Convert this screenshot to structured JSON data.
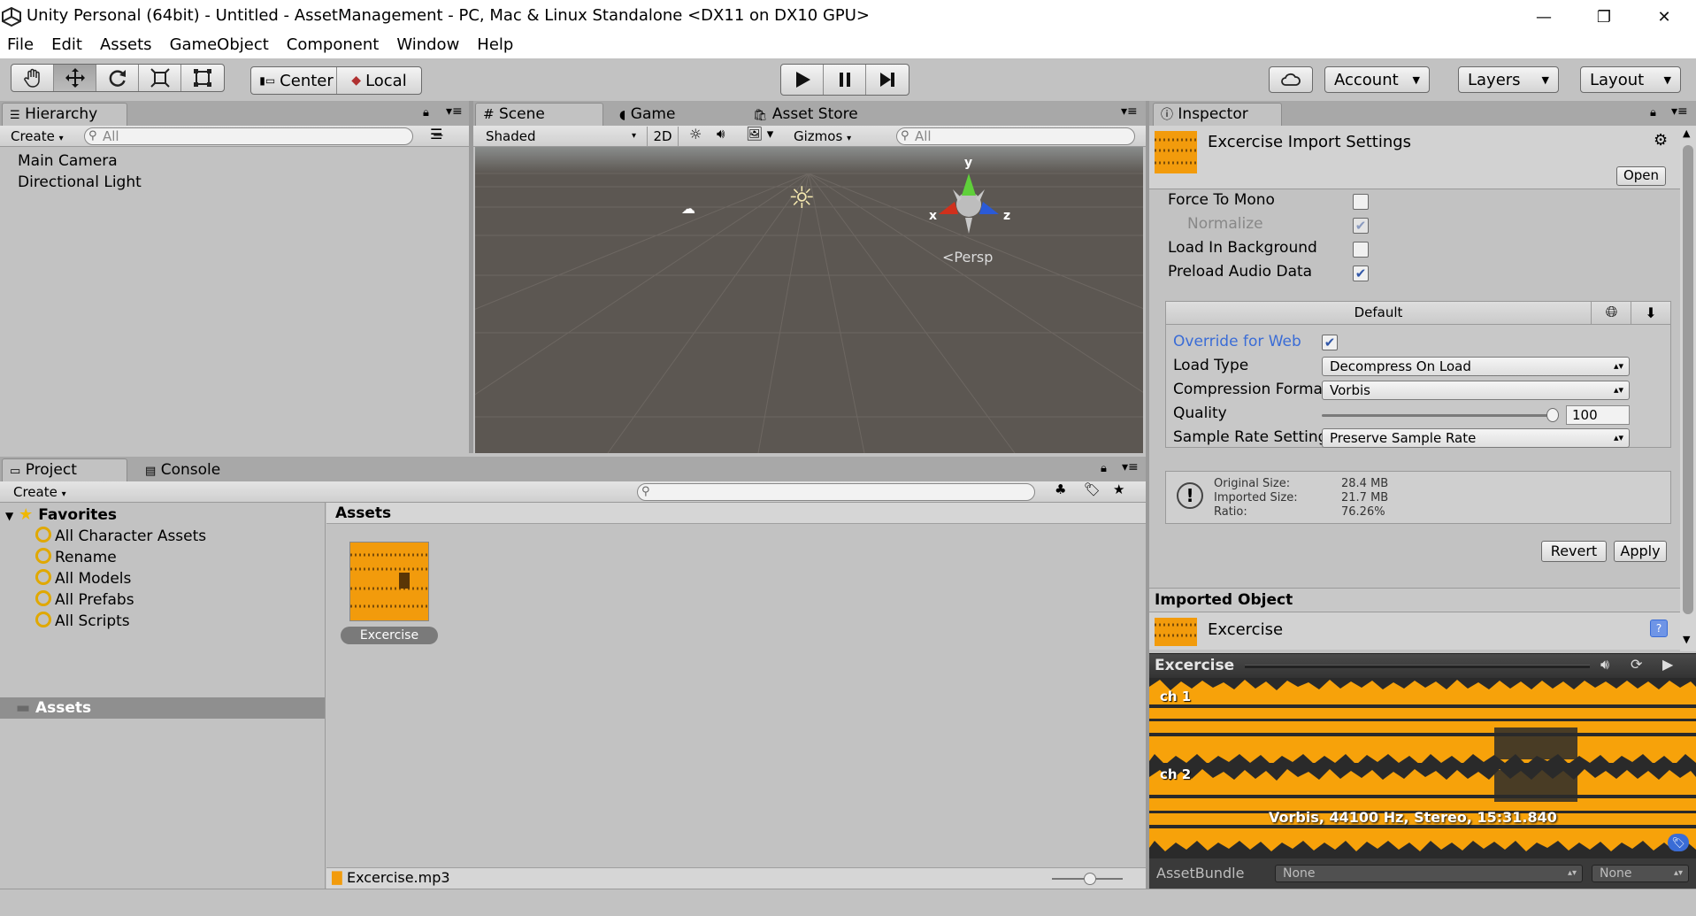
{
  "window": {
    "title": "Unity Personal (64bit) - Untitled - AssetManagement - PC, Mac & Linux Standalone <DX11 on DX10 GPU>",
    "minimize": "—",
    "restore": "❐",
    "close": "✕"
  },
  "menu": [
    "File",
    "Edit",
    "Assets",
    "GameObject",
    "Component",
    "Window",
    "Help"
  ],
  "toolbar": {
    "pivot_label": "Center",
    "space_label": "Local",
    "account_label": "Account",
    "layers_label": "Layers",
    "layout_label": "Layout"
  },
  "hierarchy": {
    "tab": "Hierarchy",
    "create": "Create",
    "search_placeholder": "All",
    "items": [
      "Main Camera",
      "Directional Light"
    ]
  },
  "scene": {
    "tabs": [
      "Scene",
      "Game",
      "Asset Store"
    ],
    "shading": "Shaded",
    "mode_2d": "2D",
    "gizmos": "Gizmos",
    "search_placeholder": "All",
    "persp_label": "Persp",
    "axes": {
      "x": "x",
      "y": "y",
      "z": "z"
    }
  },
  "inspector": {
    "tab": "Inspector",
    "title": "Excercise Import Settings",
    "open_button": "Open",
    "fields": [
      {
        "label": "Force To Mono",
        "checked": false
      },
      {
        "label": "Normalize",
        "checked": true,
        "disabled": true
      },
      {
        "label": "Load In Background",
        "checked": false
      },
      {
        "label": "Preload Audio Data",
        "checked": true
      }
    ],
    "platform_header": "Default",
    "override_label": "Override for Web",
    "override_checked": true,
    "load_type_label": "Load Type",
    "load_type_value": "Decompress On Load",
    "compression_label": "Compression Format",
    "compression_value": "Vorbis",
    "quality_label": "Quality",
    "quality_value": "100",
    "sample_rate_label": "Sample Rate Setting",
    "sample_rate_value": "Preserve Sample Rate",
    "info": {
      "original_label": "Original Size:",
      "original_value": "28.4 MB",
      "imported_label": "Imported Size:",
      "imported_value": "21.7 MB",
      "ratio_label": "Ratio:",
      "ratio_value": "76.26%"
    },
    "revert": "Revert",
    "apply": "Apply",
    "imported_object_header": "Imported Object",
    "imported_name": "Excercise",
    "preview_title": "Excercise",
    "channel1": "ch 1",
    "channel2": "ch 2",
    "preview_info": "Vorbis, 44100 Hz, Stereo, 15:31.840",
    "assetbundle_label": "AssetBundle",
    "assetbundle_value": "None",
    "assetbundle_variant": "None"
  },
  "project": {
    "tabs": [
      "Project",
      "Console"
    ],
    "create": "Create",
    "favorites_label": "Favorites",
    "favorites": [
      "All Character Assets",
      "Rename",
      "All Models",
      "All Prefabs",
      "All Scripts"
    ],
    "assets_root": "Assets",
    "assets_header": "Assets",
    "asset_name": "Excercise",
    "selected_path": "Excercise.mp3"
  },
  "colors": {
    "accent_blue": "#3a6cd6",
    "waveform": "#f7a20a",
    "panel_bg": "#c2c2c2"
  }
}
